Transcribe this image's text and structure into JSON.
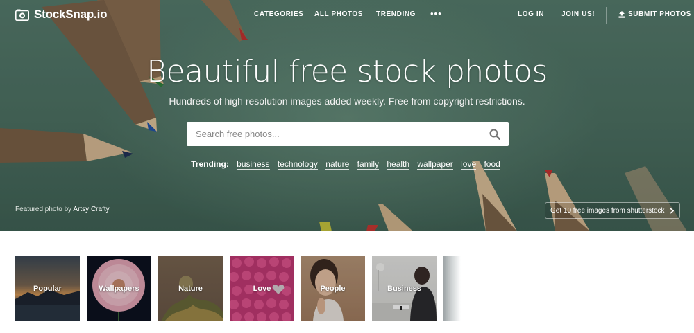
{
  "brand": {
    "name": "StockSnap.io",
    "logo_icon": "camera-icon"
  },
  "nav": {
    "categories": "CATEGORIES",
    "all_photos": "ALL PHOTOS",
    "trending": "TRENDING",
    "more": "•••",
    "login": "LOG IN",
    "join": "JOIN US!",
    "submit": "SUBMIT PHOTOS",
    "submit_icon": "upload-icon"
  },
  "hero": {
    "title": "Beautiful free stock photos",
    "subtitle_text": "Hundreds of high resolution images added weekly.",
    "subtitle_link": "Free from copyright restrictions.",
    "search_placeholder": "Search free photos...",
    "search_icon": "search-icon",
    "trending_label": "Trending:",
    "trending_tags": [
      "business",
      "technology",
      "nature",
      "family",
      "health",
      "wallpaper",
      "love",
      "food"
    ],
    "featured_prefix": "Featured photo by",
    "featured_author": "Artsy Crafty",
    "promo_label": "Get 10 free images from shutterstock",
    "promo_icon": "chevron-right-icon"
  },
  "categories": [
    {
      "label": "Popular"
    },
    {
      "label": "Wallpapers"
    },
    {
      "label": "Nature"
    },
    {
      "label": "Love"
    },
    {
      "label": "People"
    },
    {
      "label": "Business"
    }
  ],
  "colors": {
    "hero_bg": "#4f7163",
    "white": "#ffffff"
  }
}
